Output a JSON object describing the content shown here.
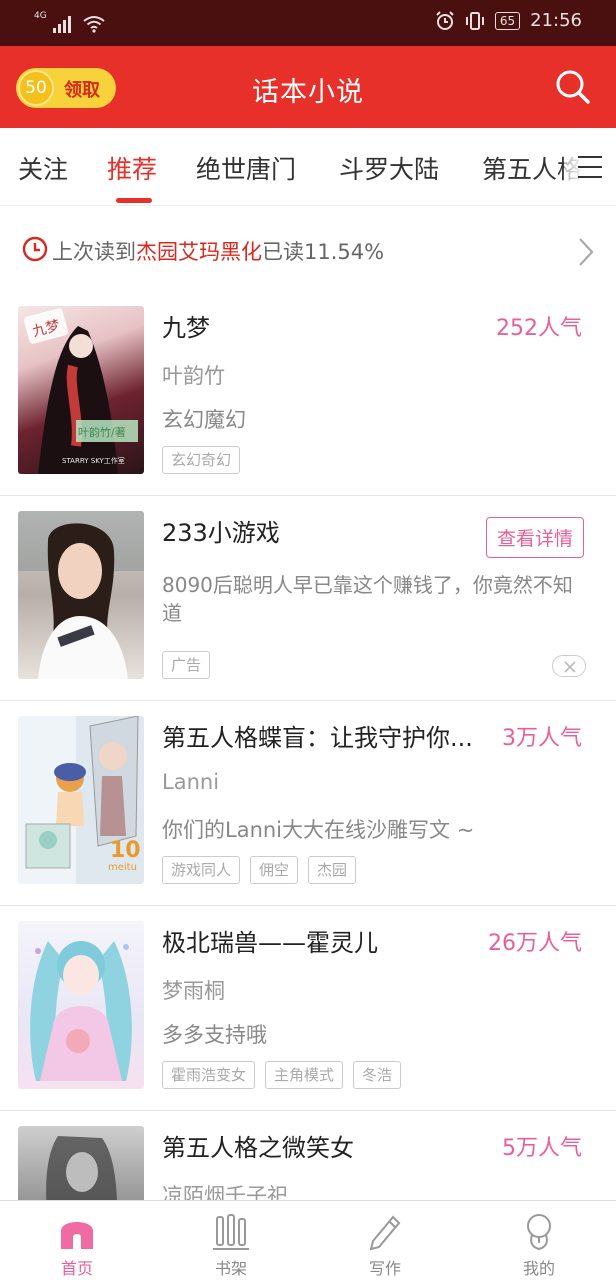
{
  "status_bar": {
    "network": "4G",
    "time": "21:56",
    "battery": "65"
  },
  "header": {
    "coin_value": "50",
    "coin_label": "领取",
    "title": "话本小说",
    "search_icon": "search-icon"
  },
  "tabs": [
    {
      "label": "关注",
      "active": false
    },
    {
      "label": "推荐",
      "active": true
    },
    {
      "label": "绝世唐门",
      "active": false
    },
    {
      "label": "斗罗大陆",
      "active": false
    },
    {
      "label": "第五人格",
      "active": false
    }
  ],
  "last_read": {
    "prefix": "上次读到",
    "book": "杰园艾玛黑化",
    "suffix": "已读11.54%"
  },
  "books": [
    {
      "title": "九梦",
      "popularity": "252人气",
      "author": "叶韵竹",
      "description": "玄幻魔幻",
      "tags": [
        "玄幻奇幻"
      ],
      "cover_text": [
        "九梦",
        "叶韵竹/著",
        "STARRY SKY工作室"
      ]
    },
    {
      "title": "233小游戏",
      "button": "查看详情",
      "description": "8090后聪明人早已靠这个赚钱了，你竟然不知道",
      "tags": [
        "广告"
      ],
      "is_ad": true
    },
    {
      "title": "第五人格蝶盲：让我守护你...",
      "popularity": "3万人气",
      "author": "Lanni",
      "description": "你们的Lanni大大在线沙雕写文 ~",
      "tags": [
        "游戏同人",
        "佣空",
        "杰园"
      ],
      "cover_text": [
        "10",
        "meitu"
      ]
    },
    {
      "title": "极北瑞兽——霍灵儿",
      "popularity": "26万人气",
      "author": "梦雨桐",
      "description": "多多支持哦",
      "tags": [
        "霍雨浩变女",
        "主角模式",
        "冬浩"
      ]
    },
    {
      "title": "第五人格之微笑女",
      "popularity": "5万人气",
      "author": "凉陌烟千子祀"
    }
  ],
  "bottom_nav": [
    {
      "label": "首页",
      "icon": "home-icon",
      "active": true
    },
    {
      "label": "书架",
      "icon": "bookshelf-icon",
      "active": false
    },
    {
      "label": "写作",
      "icon": "pencil-icon",
      "active": false
    },
    {
      "label": "我的",
      "icon": "profile-icon",
      "active": false
    }
  ],
  "colors": {
    "brand_red": "#e8302a",
    "status_bar": "#4a1010",
    "pink_accent": "#e8609a",
    "coin_yellow": "#f7d23a"
  }
}
